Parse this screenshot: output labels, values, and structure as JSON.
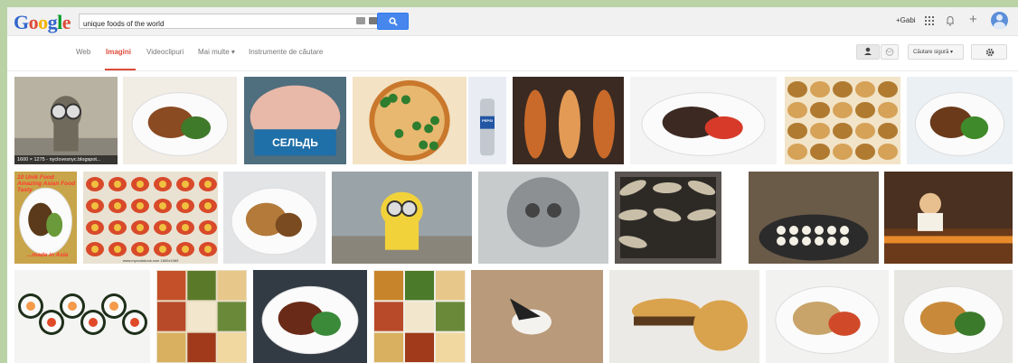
{
  "brand": {
    "logo": "Google",
    "logo_colors": [
      "#3366cc",
      "#dd4b39",
      "#f5b400",
      "#3366cc",
      "#009925",
      "#dd4b39"
    ]
  },
  "search": {
    "query": "unique foods of the world"
  },
  "header": {
    "user_name": "+Gabi"
  },
  "nav": {
    "tabs": [
      "Web",
      "Imagini",
      "Videoclipuri",
      "Mai multe ▾",
      "Instrumente de căutare"
    ],
    "active_tab": "Imagini",
    "safe_search": "Căutare sigură ▾"
  },
  "images": [
    {
      "name": "image-canned-statue",
      "icon": "sculpture",
      "caption": "1600 × 1275 - nyclovesnyc.blogspot..."
    },
    {
      "name": "image-gyro-plate",
      "icon": "food-plate"
    },
    {
      "name": "image-herring-can",
      "icon": "tin-can",
      "label": "СЕЛЬДЬ"
    },
    {
      "name": "image-pizza",
      "icon": "pizza"
    },
    {
      "name": "image-pepsi-bottle",
      "icon": "bottle",
      "label": "PEPSI"
    },
    {
      "name": "image-roast-pigs",
      "icon": "roast"
    },
    {
      "name": "image-spider-dish",
      "icon": "food-plate"
    },
    {
      "name": "image-empanadas",
      "icon": "pastry"
    },
    {
      "name": "image-curry-plate",
      "icon": "food-plate"
    },
    {
      "name": "image-top-10-dish",
      "icon": "food-plate",
      "overlay": "10 Unik Food Amazing Asian Food Tasty",
      "overlay_bottom": "...made in Asia"
    },
    {
      "name": "image-noodle-trays",
      "icon": "trays",
      "watermark": "www.mycookbook.com   1600x1069"
    },
    {
      "name": "image-dumplings",
      "icon": "food-plate"
    },
    {
      "name": "image-minion-cans",
      "icon": "sculpture"
    },
    {
      "name": "image-skull-cans",
      "icon": "skull"
    },
    {
      "name": "image-grilled-fish-tray",
      "icon": "fish"
    },
    {
      "name": "image-street-cooking",
      "icon": "cooking"
    },
    {
      "name": "image-market-chef",
      "icon": "chef"
    },
    {
      "name": "image-sushi-rolls",
      "icon": "sushi"
    },
    {
      "name": "image-food-collage",
      "icon": "collage"
    },
    {
      "name": "image-stir-fry",
      "icon": "food-plate"
    },
    {
      "name": "image-food-grid",
      "icon": "collage"
    },
    {
      "name": "image-bird",
      "icon": "bird"
    },
    {
      "name": "image-burger",
      "icon": "burger"
    },
    {
      "name": "image-noodles",
      "icon": "food-plate"
    },
    {
      "name": "image-soup-bowl",
      "icon": "food-plate"
    }
  ]
}
